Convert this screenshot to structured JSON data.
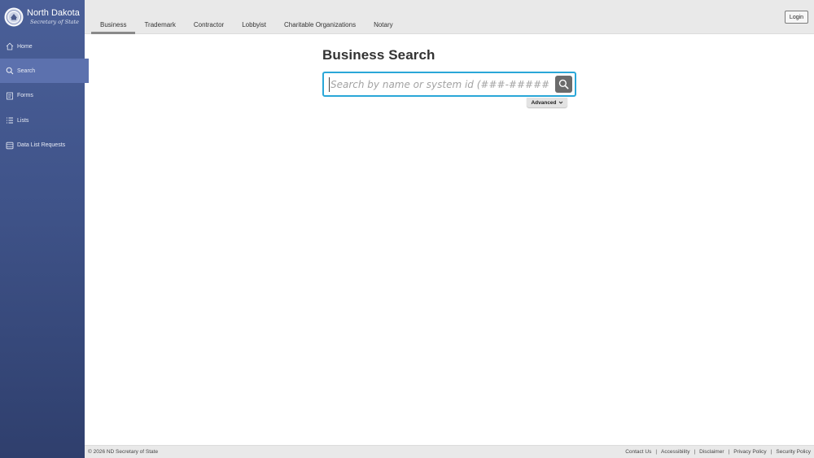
{
  "brand": {
    "title": "North Dakota",
    "subtitle": "Secretary of State"
  },
  "sidebar": {
    "items": [
      {
        "label": "Home",
        "icon": "home-icon"
      },
      {
        "label": "Search",
        "icon": "search-icon",
        "active": true
      },
      {
        "label": "Forms",
        "icon": "forms-icon"
      },
      {
        "label": "Lists",
        "icon": "list-icon"
      },
      {
        "label": "Data List Requests",
        "icon": "database-icon"
      }
    ]
  },
  "tabs": [
    {
      "label": "Business",
      "active": true
    },
    {
      "label": "Trademark"
    },
    {
      "label": "Contractor"
    },
    {
      "label": "Lobbyist"
    },
    {
      "label": "Charitable Organizations"
    },
    {
      "label": "Notary"
    }
  ],
  "header": {
    "login_label": "Login"
  },
  "main": {
    "title": "Business Search",
    "search_placeholder": "Search by name or system id (###-#####)",
    "search_value": "",
    "advanced_label": "Advanced"
  },
  "footer": {
    "copyright": "© 2026 ND Secretary of State",
    "links": [
      "Contact Us",
      "Accessibility",
      "Disclaimer",
      "Privacy Policy",
      "Security Policy"
    ]
  },
  "colors": {
    "sidebar": "#3f5389",
    "sidebar_active": "#5c71ae",
    "search_border": "#2aa7d8",
    "search_button": "#6b6b6b"
  }
}
